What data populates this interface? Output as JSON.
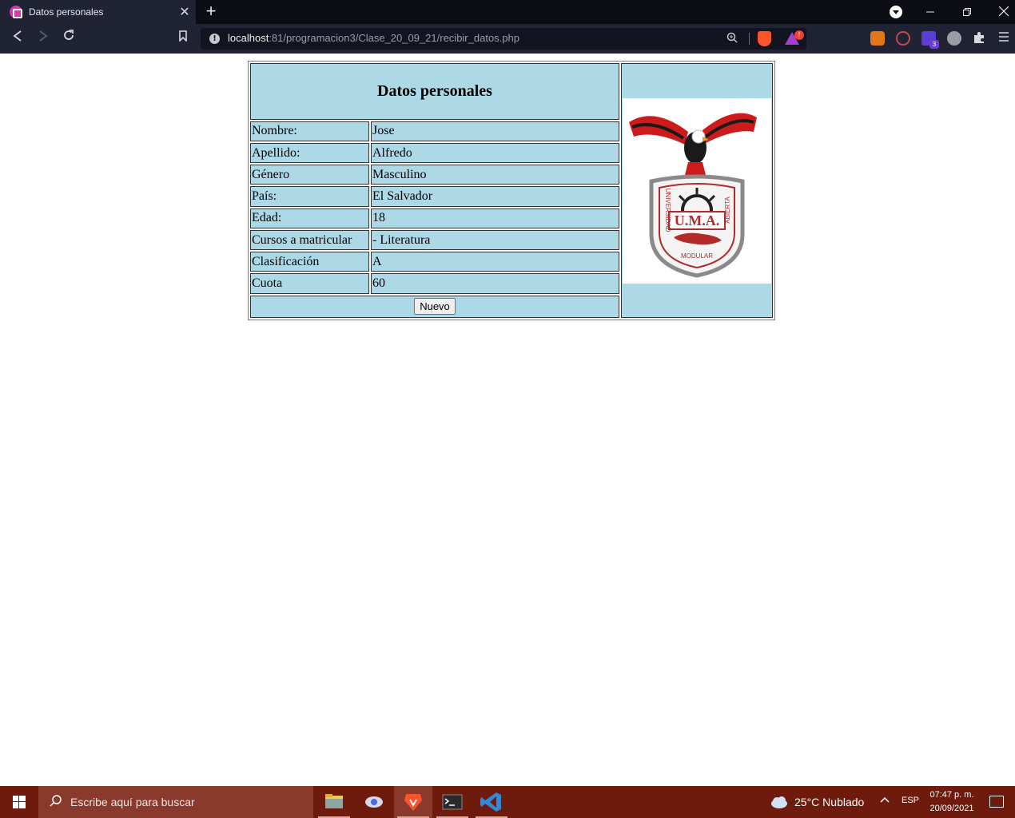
{
  "browser": {
    "tab_title": "Datos personales",
    "tab_close": "✕",
    "new_tab": "+",
    "url_host": "localhost",
    "url_rest": ":81/programacion3/Clase_20_09_21/recibir_datos.php",
    "rewards_badge": "!",
    "extension_badge": "3",
    "icons": [
      "back-icon",
      "forward-icon",
      "reload-icon",
      "bookmark-icon",
      "info-icon",
      "zoom-icon",
      "brave-shields-icon",
      "brave-rewards-icon",
      "metamask-icon",
      "extension-icon",
      "puzzle-icon",
      "menu-icon"
    ]
  },
  "page": {
    "title": "Datos personales",
    "rows": [
      {
        "label": "Nombre:",
        "value": "Jose"
      },
      {
        "label": "Apellido:",
        "value": "Alfredo"
      },
      {
        "label": "Género",
        "value": "Masculino"
      },
      {
        "label": "País:",
        "value": "El Salvador"
      },
      {
        "label": "Edad:",
        "value": "18"
      },
      {
        "label": "Cursos a matricular",
        "value": "- Literatura"
      },
      {
        "label": "Clasificación",
        "value": "A"
      },
      {
        "label": "Cuota",
        "value": "60"
      }
    ],
    "button_label": "Nuevo",
    "logo": {
      "top_text": "U.M.A.",
      "left_text": "UNIVERSIDAD",
      "right_text": "ABIERTA",
      "bottom_text": "MODULAR"
    }
  },
  "taskbar": {
    "search_placeholder": "Escribe aquí para buscar",
    "weather": "25°C  Nublado",
    "language": "ESP",
    "time": "07:47 p. m.",
    "date": "20/09/2021"
  },
  "colors": {
    "table_cell": "#add8e6",
    "taskbar": "#6e1a0d",
    "browser_chrome": "#202333"
  }
}
